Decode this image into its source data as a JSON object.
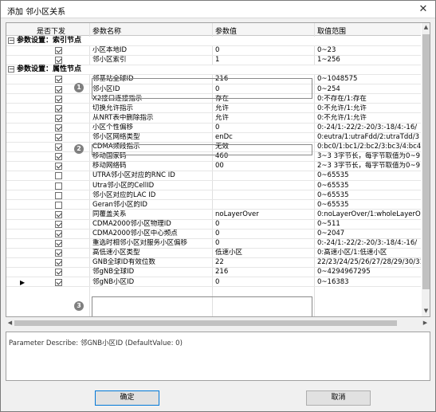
{
  "window": {
    "title": "添加 邻小区关系",
    "close_glyph": "✕"
  },
  "columns": {
    "enabled": "是否下发",
    "name": "参数名称",
    "value": "参数值",
    "range": "取值范围"
  },
  "rows": [
    {
      "type": "group",
      "label": "参数设置：索引节点"
    },
    {
      "type": "item",
      "checked": true,
      "name": "小区本地ID",
      "value": "0",
      "range": "0~23"
    },
    {
      "type": "item",
      "checked": true,
      "name": "邻小区索引",
      "value": "1",
      "range": "1~256"
    },
    {
      "type": "group",
      "label": "参数设置：属性节点"
    },
    {
      "type": "item",
      "checked": true,
      "name": "邻基站全球ID",
      "value": "216",
      "range": "0~1048575"
    },
    {
      "type": "item",
      "checked": true,
      "name": "邻小区ID",
      "value": "0",
      "range": "0~254"
    },
    {
      "type": "item",
      "checked": true,
      "name": "X2接口连接指示",
      "value": "存在",
      "range": "0:不存在/1:存在"
    },
    {
      "type": "item",
      "checked": true,
      "name": "切换允许指示",
      "value": "允许",
      "range": "0:不允许/1:允许"
    },
    {
      "type": "item",
      "checked": true,
      "name": "从NRT表中删除指示",
      "value": "允许",
      "range": "0:不允许/1:允许"
    },
    {
      "type": "item",
      "checked": true,
      "name": "小区个性偏移",
      "value": "0",
      "range": "0:-24/1:-22/2:-20/3:-18/4:-16/"
    },
    {
      "type": "item",
      "checked": true,
      "name": "邻小区网络类型",
      "value": "enDc",
      "range": "0:eutra/1:utraFdd/2:utraTdd/3"
    },
    {
      "type": "item",
      "checked": true,
      "name": "CDMA频段指示",
      "value": "无效",
      "range": "0:bc0/1:bc1/2:bc2/3:bc3/4:bc4/5:"
    },
    {
      "type": "item",
      "checked": true,
      "name": "移动国家码",
      "value": "460",
      "range": "3~3  3字节长，每字节取值为0~9"
    },
    {
      "type": "item",
      "checked": true,
      "name": "移动网络码",
      "value": "00",
      "range": "2~3  3字节长，每字节取值为0~9"
    },
    {
      "type": "item",
      "checked": false,
      "name": "UTRA邻小区对应的RNC ID",
      "value": "",
      "range": "0~65535"
    },
    {
      "type": "item",
      "checked": false,
      "name": "Utra邻小区的CellID",
      "value": "",
      "range": "0~65535"
    },
    {
      "type": "item",
      "checked": false,
      "name": "邻小区对应的LAC ID",
      "value": "",
      "range": "0~65535"
    },
    {
      "type": "item",
      "checked": false,
      "name": "Geran邻小区的ID",
      "value": "",
      "range": "0~65535"
    },
    {
      "type": "item",
      "checked": true,
      "name": "同覆盖关系",
      "value": "noLayerOver",
      "range": "0:noLayerOver/1:wholeLayerOver"
    },
    {
      "type": "item",
      "checked": true,
      "name": "CDMA2000邻小区物理ID",
      "value": "0",
      "range": "0~511"
    },
    {
      "type": "item",
      "checked": true,
      "name": "CDMA2000邻小区中心频点",
      "value": "0",
      "range": "0~2047"
    },
    {
      "type": "item",
      "checked": true,
      "name": "重选时相邻小区对服务小区偏移",
      "value": "0",
      "range": "0:-24/1:-22/2:-20/3:-18/4:-16/"
    },
    {
      "type": "item",
      "checked": true,
      "name": "高低速小区类型",
      "value": "低速小区",
      "range": "0:高速小区/1:低速小区"
    },
    {
      "type": "item",
      "checked": true,
      "name": "GNB全球ID有效位数",
      "value": "22",
      "range": "22/23/24/25/26/27/28/29/30/31/3"
    },
    {
      "type": "item",
      "checked": true,
      "name": "邻gNB全球ID",
      "value": "216",
      "range": "0~4294967295"
    },
    {
      "type": "item",
      "checked": true,
      "name": "邻gNB小区ID",
      "value": "0",
      "range": "0~16383",
      "current": true
    }
  ],
  "markers": [
    "1",
    "2",
    "3"
  ],
  "description": "Parameter Describe: 邻GNB小区ID (DefaultValue: 0)",
  "buttons": {
    "ok": "确定",
    "cancel": "取消"
  },
  "icons": {
    "current_row": "▶",
    "scroll_up": "▲",
    "scroll_down": "▼",
    "scroll_left": "◀",
    "scroll_right": "▶",
    "collapse": "−"
  }
}
